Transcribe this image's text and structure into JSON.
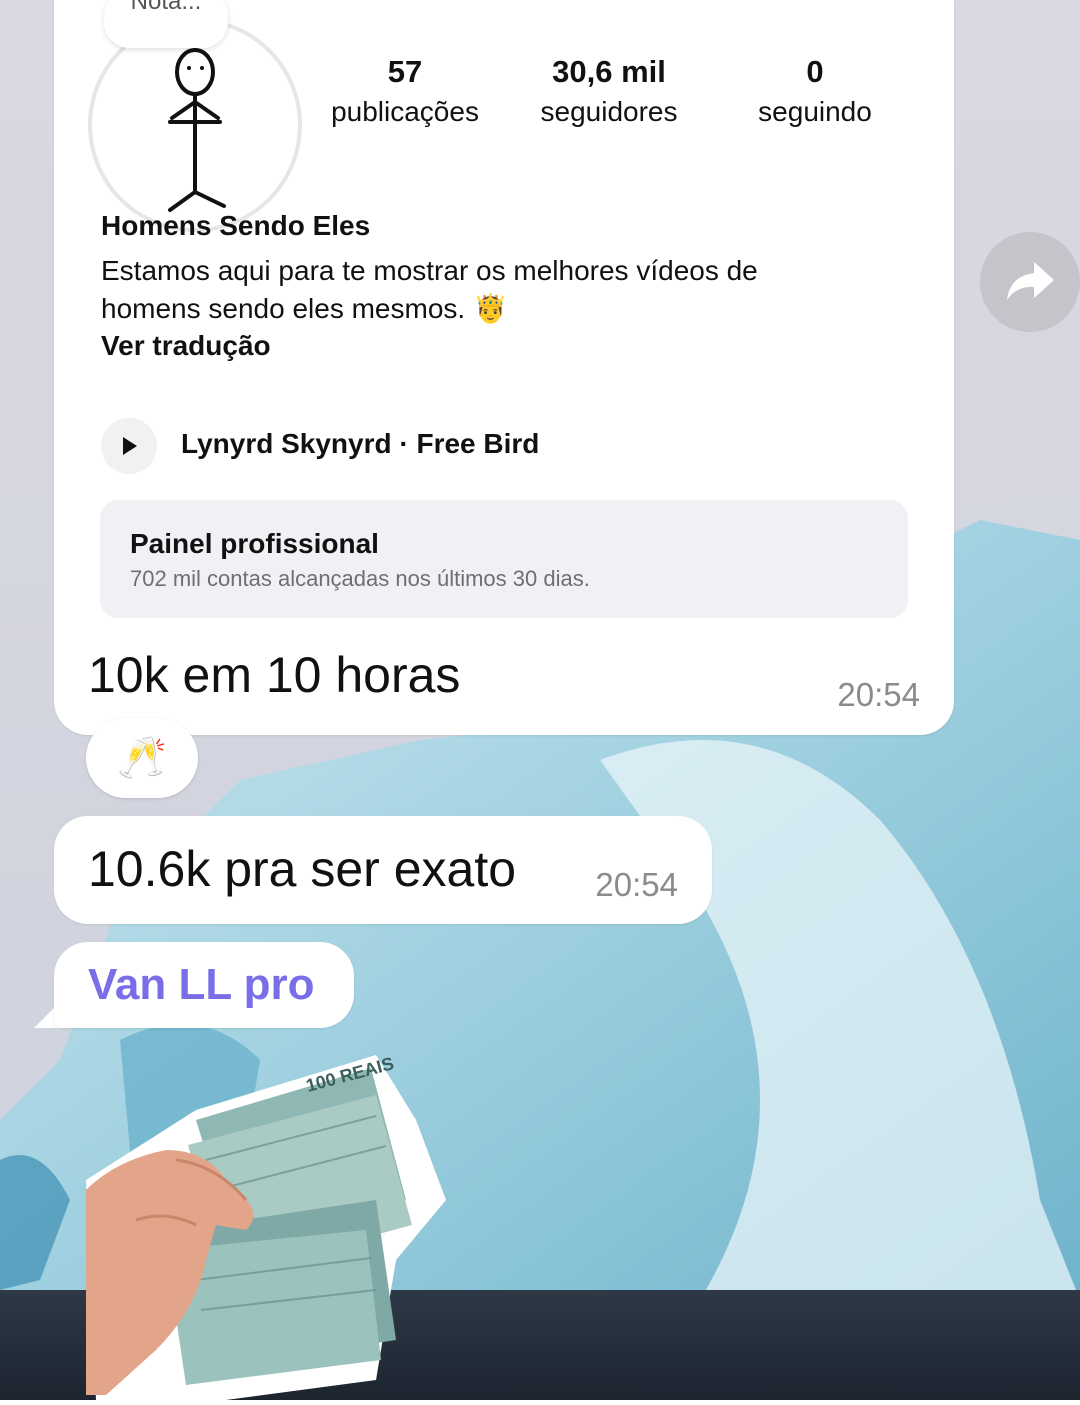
{
  "profile": {
    "note_label": "Nota...",
    "stats": [
      {
        "value": "57",
        "label": "publicações"
      },
      {
        "value": "30,6 mil",
        "label": "seguidores"
      },
      {
        "value": "0",
        "label": "seguindo"
      }
    ],
    "name": "Homens Sendo Eles",
    "bio": "Estamos aqui para te mostrar os melhores vídeos de homens sendo eles mesmos.",
    "bio_emoji": "🤴",
    "translate_link": "Ver tradução",
    "music": {
      "icon": "play-icon",
      "track": "Lynyrd Skynyrd · Free Bird"
    },
    "pro_panel": {
      "title": "Painel profissional",
      "subtitle": "702 mil contas alcançadas nos últimos 30 dias."
    }
  },
  "messages": [
    {
      "text": "10k em 10 horas",
      "time": "20:54",
      "reaction": "🥂"
    },
    {
      "text": "10.6k pra ser exato",
      "time": "20:54"
    },
    {
      "text": "Van LL pro"
    }
  ],
  "forward_icon": "share-arrow-icon",
  "sticker": {
    "icon": "money-stack-in-hand-icon",
    "banknote_text": "100 REAIS"
  },
  "colors": {
    "sender_name": "#7a6ee8",
    "bubble": "#ffffff",
    "timestamp": "#8b8b8b"
  }
}
